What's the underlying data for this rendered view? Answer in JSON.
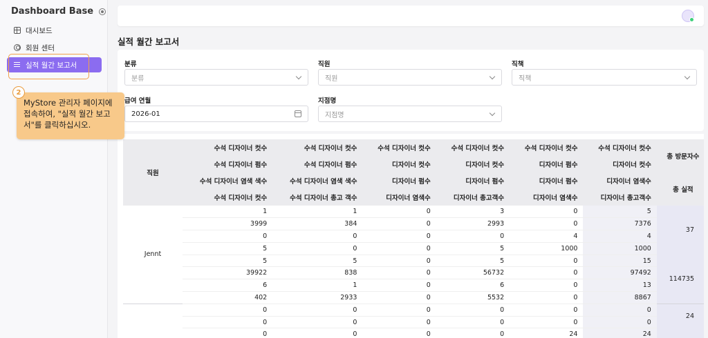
{
  "sidebar": {
    "brand": "Dashboard Base",
    "items": [
      {
        "label": "대시보드",
        "icon": "grid-icon"
      },
      {
        "label": "회원 센터",
        "icon": "user-circle-icon"
      },
      {
        "label": "실적 월간 보고서",
        "icon": "list-icon",
        "active": true
      }
    ]
  },
  "tooltip": {
    "step": "2",
    "text": "MyStore 관리자 페이지에 접속하여, \"실적 월간 보고서\"를 클릭하십시오."
  },
  "page": {
    "title": "실적 월간 보고서"
  },
  "filters": {
    "category": {
      "label": "분류",
      "placeholder": "분류"
    },
    "staff": {
      "label": "직원",
      "placeholder": "직원"
    },
    "position": {
      "label": "직책",
      "placeholder": "직책"
    },
    "pay_month": {
      "label": "급여 연월",
      "value": "2026-01"
    },
    "branch": {
      "label": "지점명",
      "placeholder": "지점명"
    }
  },
  "table": {
    "staff_header": "직원",
    "header_rows": [
      [
        "수석 디자이너 컷수",
        "수석 디자이너 컷수",
        "수석 디자이너 컷수",
        "수석 디자이너 컷수",
        "수석 디자이너 컷수",
        "수석 디자이너 컷수"
      ],
      [
        "수석 디자이너 펌수",
        "수석 디자이너 펌수",
        "디자이너 컷수",
        "디자이너 컷수",
        "디자이너 펌수",
        "디자이너 컷수"
      ],
      [
        "수석 디자이너 염색 색수",
        "수석 디자이너 염색 색수",
        "디자이너 펌수",
        "디자이너 펌수",
        "디자이너 펌수",
        "디자이너 염색수"
      ],
      [
        "수석 디자이너 컷수",
        "수석 디자이너 총고 객수",
        "디자이너 염색수",
        "디자이너 총고객수",
        "디자이너 염색수",
        "디자이너 총고객수"
      ]
    ],
    "total_headers": [
      "총 방문자수",
      "총 실적"
    ],
    "groups": [
      {
        "staff": "Jennt",
        "rows": [
          [
            "1",
            "1",
            "0",
            "3",
            "0",
            "5"
          ],
          [
            "3999",
            "384",
            "0",
            "2993",
            "0",
            "7376"
          ],
          [
            "0",
            "0",
            "0",
            "0",
            "4",
            "4"
          ],
          [
            "5",
            "0",
            "0",
            "5",
            "1000",
            "1000"
          ],
          [
            "5",
            "5",
            "0",
            "5",
            "0",
            "15"
          ],
          [
            "39922",
            "838",
            "0",
            "56732",
            "0",
            "97492"
          ],
          [
            "6",
            "1",
            "0",
            "6",
            "0",
            "13"
          ],
          [
            "402",
            "2933",
            "0",
            "5532",
            "0",
            "8867"
          ]
        ],
        "totals": [
          "37",
          "114735"
        ]
      },
      {
        "staff": "",
        "rows": [
          [
            "0",
            "0",
            "0",
            "0",
            "0",
            "0"
          ],
          [
            "0",
            "0",
            "0",
            "0",
            "0",
            "0"
          ],
          [
            "0",
            "0",
            "0",
            "0",
            "24",
            "24"
          ]
        ],
        "totals": [
          "24",
          ""
        ]
      }
    ]
  }
}
